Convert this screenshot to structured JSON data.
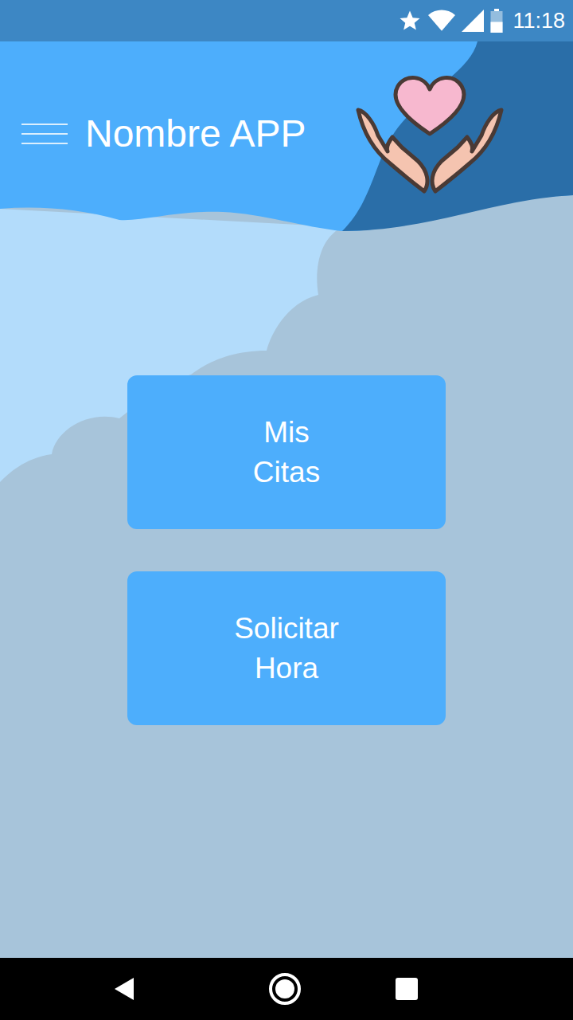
{
  "status_bar": {
    "time": "11:18"
  },
  "app_bar": {
    "title": "Nombre APP"
  },
  "buttons": [
    {
      "label": "Mis\nCitas"
    },
    {
      "label": "Solicitar\nHora"
    }
  ]
}
